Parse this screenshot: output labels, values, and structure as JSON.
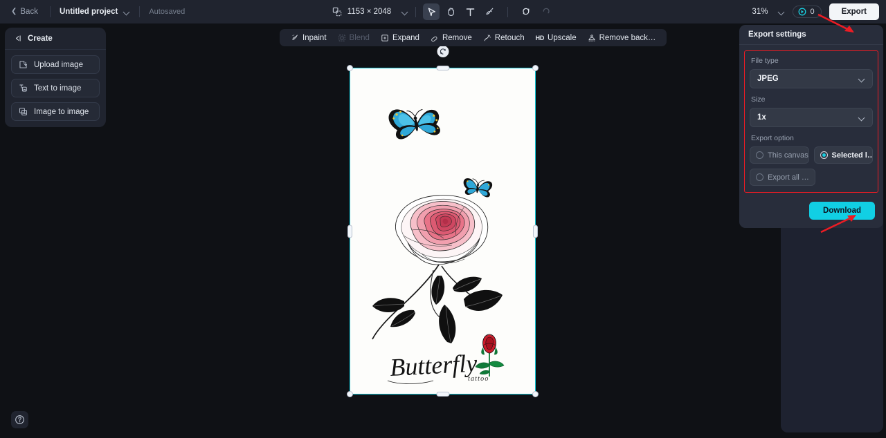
{
  "header": {
    "back_label": "Back",
    "project_name": "Untitled project",
    "autosaved_label": "Autosaved",
    "canvas_size_label": "1153 × 2048",
    "zoom_level": "31%",
    "credits_count": "0",
    "export_label": "Export",
    "tools": [
      {
        "name": "select-tool",
        "icon": "cursor-arrow-icon",
        "active": true
      },
      {
        "name": "hand-tool",
        "icon": "hand-icon",
        "active": false
      },
      {
        "name": "text-tool",
        "icon": "text-t-icon",
        "active": false
      },
      {
        "name": "brush-tool",
        "icon": "brush-icon",
        "active": false
      },
      {
        "name": "undo",
        "icon": "undo-icon",
        "active": false
      },
      {
        "name": "redo",
        "icon": "redo-icon",
        "active": false
      }
    ]
  },
  "sidebar": {
    "title": "Create",
    "items": [
      {
        "label": "Upload image",
        "icon": "upload-image-icon"
      },
      {
        "label": "Text to image",
        "icon": "text-to-image-icon"
      },
      {
        "label": "Image to image",
        "icon": "image-to-image-icon"
      }
    ]
  },
  "canvas_toolbar": {
    "items": [
      {
        "label": "Inpaint",
        "icon": "inpaint-icon",
        "disabled": false
      },
      {
        "label": "Blend",
        "icon": "blend-icon",
        "disabled": true
      },
      {
        "label": "Expand",
        "icon": "expand-icon",
        "disabled": false
      },
      {
        "label": "Remove",
        "icon": "eraser-icon",
        "disabled": false
      },
      {
        "label": "Retouch",
        "icon": "retouch-icon",
        "disabled": false
      },
      {
        "label": "Upscale",
        "icon": "hd-icon",
        "badge": "HD",
        "disabled": false
      },
      {
        "label": "Remove back…",
        "icon": "remove-background-icon",
        "disabled": false
      }
    ]
  },
  "export_panel": {
    "title": "Export settings",
    "file_type_label": "File type",
    "file_type_value": "JPEG",
    "size_label": "Size",
    "size_value": "1x",
    "export_option_label": "Export option",
    "options": [
      {
        "label": "This canvas",
        "selected": false
      },
      {
        "label": "Selected l…",
        "selected": true
      },
      {
        "label": "Export all …",
        "selected": false
      }
    ],
    "download_label": "Download"
  },
  "artwork": {
    "title_script": "Butterfly",
    "subtitle_script": "tattoo",
    "description": "Tattoo design sheet: two teal butterflies, large pink rose with black leaves on curving stem, small red rose, cursive Butterfly lettering",
    "colors": {
      "butterfly_wing": "#2fa8d8",
      "butterfly_outline": "#111111",
      "butterfly_accent": "#e8c63a",
      "rose_pink_dark": "#d9415b",
      "rose_pink_light": "#f5b8c2",
      "rose_red": "#cc1b2a",
      "leaf_black": "#121212",
      "leaf_green": "#0f7a38",
      "paper": "#fdfdfb"
    }
  },
  "colors": {
    "accent_cyan": "#11cfe4",
    "selection_border": "#13c9d8",
    "annotation_red": "#ec1c24",
    "app_bg": "#0f1115",
    "panel_bg": "#282d3b",
    "chrome_bg": "#20242f"
  },
  "help": {
    "tooltip": "Help",
    "icon": "question-mark-icon"
  }
}
